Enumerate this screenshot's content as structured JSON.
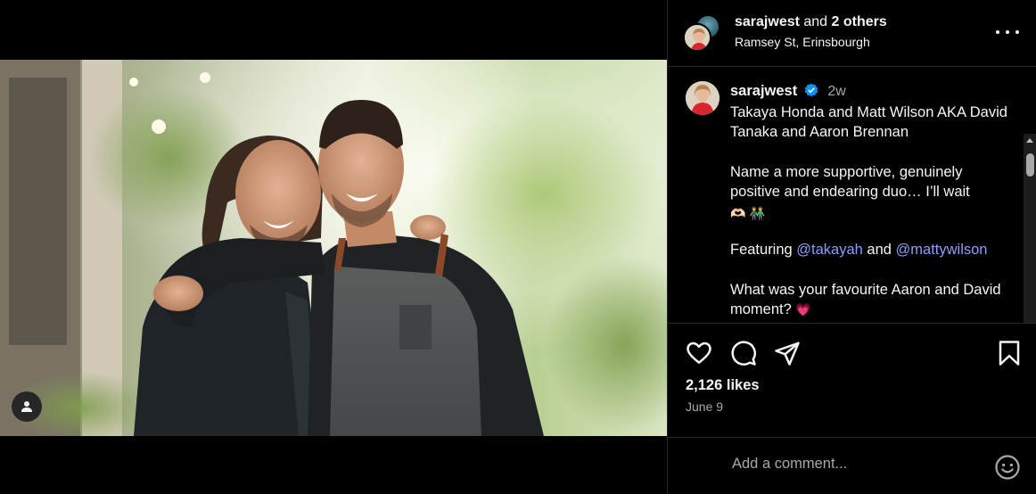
{
  "post": {
    "author": "sarajwest",
    "coauthors_suffix": " and ",
    "coauthors_count_label": "2 others",
    "location": "Ramsey St, Erinsbourgh",
    "caption": {
      "username": "sarajwest",
      "time_ago": "2w",
      "line1": "Takaya Honda and Matt Wilson AKA David Tanaka and Aaron Brennan",
      "line2": "Name a more supportive, genuinely positive and endearing duo… I’ll wait",
      "line2_emojis": "🫶🏻 👬",
      "featuring_prefix": "Featuring ",
      "mention1": "@takayah",
      "featuring_and": " and ",
      "mention2": "@mattywilson",
      "line4": "What was your favourite Aaron and David moment?",
      "line4_emoji": "💗"
    },
    "likes": "2,126 likes",
    "date": "June 9"
  },
  "comment": {
    "placeholder": "Add a comment..."
  },
  "icons": {
    "like": "heart-icon",
    "comment": "comment-bubble-icon",
    "share": "paper-plane-icon",
    "save": "bookmark-icon",
    "more": "more-dots-icon",
    "tag": "user-tag-icon",
    "emoji": "smiley-icon",
    "verified": "verified-badge-icon"
  },
  "colors": {
    "verified": "#0095f6",
    "mention": "#8c9efc",
    "secondary_text": "#a8a8a8",
    "divider": "#262626"
  }
}
